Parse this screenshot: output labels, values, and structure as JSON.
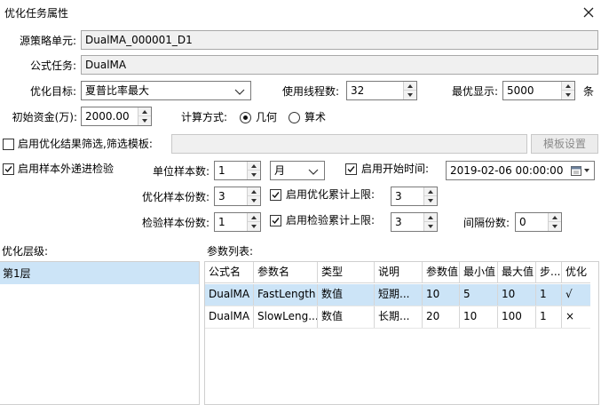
{
  "window": {
    "title": "优化任务属性"
  },
  "source_unit": {
    "label": "源策略单元:",
    "value": "DualMA_000001_D1"
  },
  "formula_task": {
    "label": "公式任务:",
    "value": "DualMA"
  },
  "opt_target": {
    "label": "优化目标:",
    "value": "夏普比率最大"
  },
  "threads": {
    "label": "使用线程数:",
    "value": "32"
  },
  "best_display": {
    "label": "最优显示:",
    "value": "5000",
    "unit": "条"
  },
  "initial_capital": {
    "label": "初始资金(万):",
    "value": "2000.00"
  },
  "calc_method": {
    "label": "计算方式:",
    "options": [
      "几何",
      "算术"
    ],
    "selected": "几何"
  },
  "filter": {
    "label": "启用优化结果筛选,筛选模板:",
    "checked": false,
    "value": "",
    "button": "模板设置"
  },
  "oos": {
    "label": "启用样本外递进检验",
    "checked": true
  },
  "unit_sample": {
    "label": "单位样本数:",
    "value": "1",
    "unit_value": "月"
  },
  "start_time": {
    "label": "启用开始时间:",
    "checked": true,
    "value": "2019-02-06 00:00:00"
  },
  "opt_sample": {
    "label": "优化样本份数:",
    "value": "3"
  },
  "opt_cum": {
    "label": "启用优化累计上限:",
    "checked": true,
    "value": "3"
  },
  "test_sample": {
    "label": "检验样本份数:",
    "value": "1"
  },
  "test_cum": {
    "label": "启用检验累计上限:",
    "checked": true,
    "value": "3"
  },
  "interval": {
    "label": "间隔份数:",
    "value": "0"
  },
  "layers": {
    "label": "优化层级:",
    "items": [
      "第1层"
    ]
  },
  "params": {
    "label": "参数列表:",
    "headers": [
      "公式名",
      "参数名",
      "类型",
      "说明",
      "参数值",
      "最小值",
      "最大值",
      "步...",
      "优化"
    ],
    "rows": [
      [
        "DualMA",
        "FastLength",
        "数值",
        "短期...",
        "10",
        "5",
        "10",
        "1",
        "√"
      ],
      [
        "DualMA",
        "SlowLeng...",
        "数值",
        "长期...",
        "20",
        "10",
        "100",
        "1",
        "×"
      ]
    ]
  },
  "colors": {
    "selection": "#cce4f7",
    "accent": "#0078d7"
  }
}
